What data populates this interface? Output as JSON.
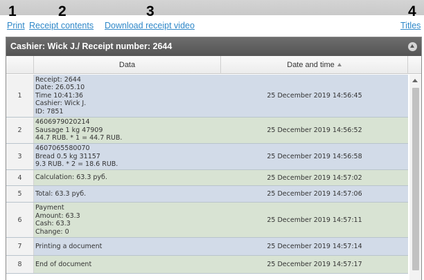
{
  "markers": [
    "1",
    "2",
    "3",
    "4"
  ],
  "links": {
    "print": "Print",
    "receipt_contents": "Receipt contents",
    "download_video": "Download receipt video",
    "titles": "Titles"
  },
  "panel": {
    "title": "Cashier: Wick J./ Receipt number: 2644"
  },
  "columns": {
    "data": "Data",
    "datetime": "Date and time"
  },
  "colors": {
    "blue_row": "#d2dbe8",
    "green_row": "#d8e3d3",
    "link": "#2e87c8"
  },
  "rows": [
    {
      "num": "1",
      "lines": [
        "Receipt: 2644",
        "Date: 26.05.10",
        "Time 10:41:36",
        "Cashier: Wick J.",
        "ID: 7851"
      ],
      "datetime": "25 December 2019 14:56:45",
      "color": "blue"
    },
    {
      "num": "2",
      "lines": [
        "4606979020214",
        "Sausage 1 kg 47909",
        "44.7 RUB. * 1 = 44.7 RUB."
      ],
      "datetime": "25 December 2019 14:56:52",
      "color": "green"
    },
    {
      "num": "3",
      "lines": [
        "4607065580070",
        "Bread 0.5 kg 31157",
        "9.3 RUB. * 2 = 18.6 RUB."
      ],
      "datetime": "25 December 2019 14:56:58",
      "color": "blue"
    },
    {
      "num": "4",
      "lines": [
        "Calculation: 63.3 руб."
      ],
      "datetime": "25 December 2019 14:57:02",
      "color": "green"
    },
    {
      "num": "5",
      "lines": [
        "Total: 63.3 руб."
      ],
      "datetime": "25 December 2019 14:57:06",
      "color": "blue"
    },
    {
      "num": "6",
      "lines": [
        "Payment",
        "Amount: 63.3",
        "Cash: 63.3",
        "Change: 0"
      ],
      "datetime": "25 December 2019 14:57:11",
      "color": "green"
    },
    {
      "num": "7",
      "lines": [
        "Printing a document"
      ],
      "datetime": "25 December 2019 14:57:14",
      "color": "blue"
    },
    {
      "num": "8",
      "lines": [
        "End of document"
      ],
      "datetime": "25 December 2019 14:57:17",
      "color": "green"
    }
  ]
}
